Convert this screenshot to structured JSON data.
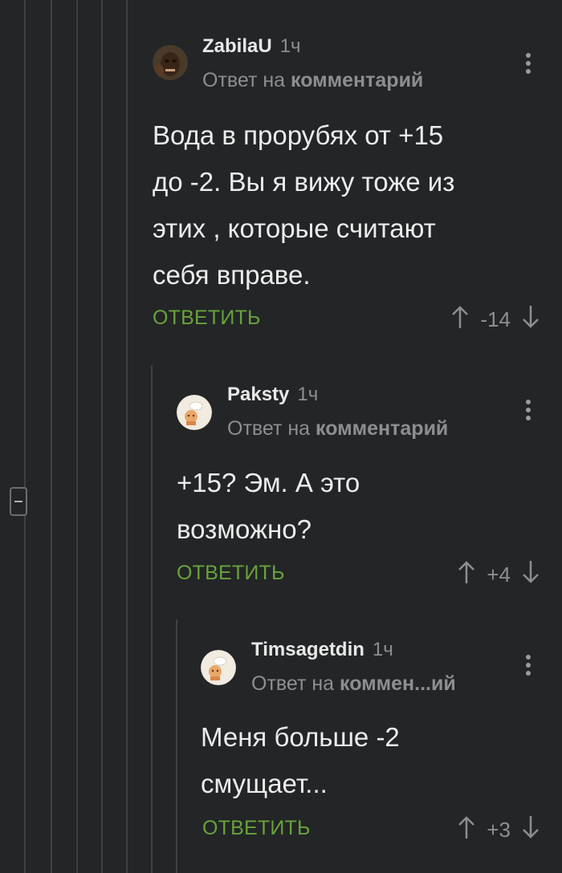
{
  "comments": [
    {
      "username": "ZabilaU",
      "time": "1ч",
      "reply_prefix": "Ответ на",
      "reply_target": "комментарий",
      "body_lines": [
        "Вода в прорубях от +15",
        "до -2. Вы я вижу тоже из",
        "этих , которые считают",
        "себя вправе."
      ],
      "reply_label": "ОТВЕТИТЬ",
      "score": "-14"
    },
    {
      "username": "Paksty",
      "time": "1ч",
      "reply_prefix": "Ответ на",
      "reply_target": "комментарий",
      "body_lines": [
        "+15? Эм. А это",
        "возможно?"
      ],
      "reply_label": "ОТВЕТИТЬ",
      "score": "+4"
    },
    {
      "username": "Timsagetdin",
      "time": "1ч",
      "reply_prefix": "Ответ на",
      "reply_target": "коммен...ий",
      "body_lines": [
        "Меня больше -2",
        "смущает..."
      ],
      "reply_label": "ОТВЕТИТЬ",
      "score": "+3"
    }
  ],
  "colors": {
    "background": "#232527",
    "reply_green": "#68a33a",
    "muted": "#8c8f92"
  },
  "icons": [
    "collapse-thread-icon",
    "kebab-menu-icon",
    "upvote-arrow-icon",
    "downvote-arrow-icon"
  ]
}
